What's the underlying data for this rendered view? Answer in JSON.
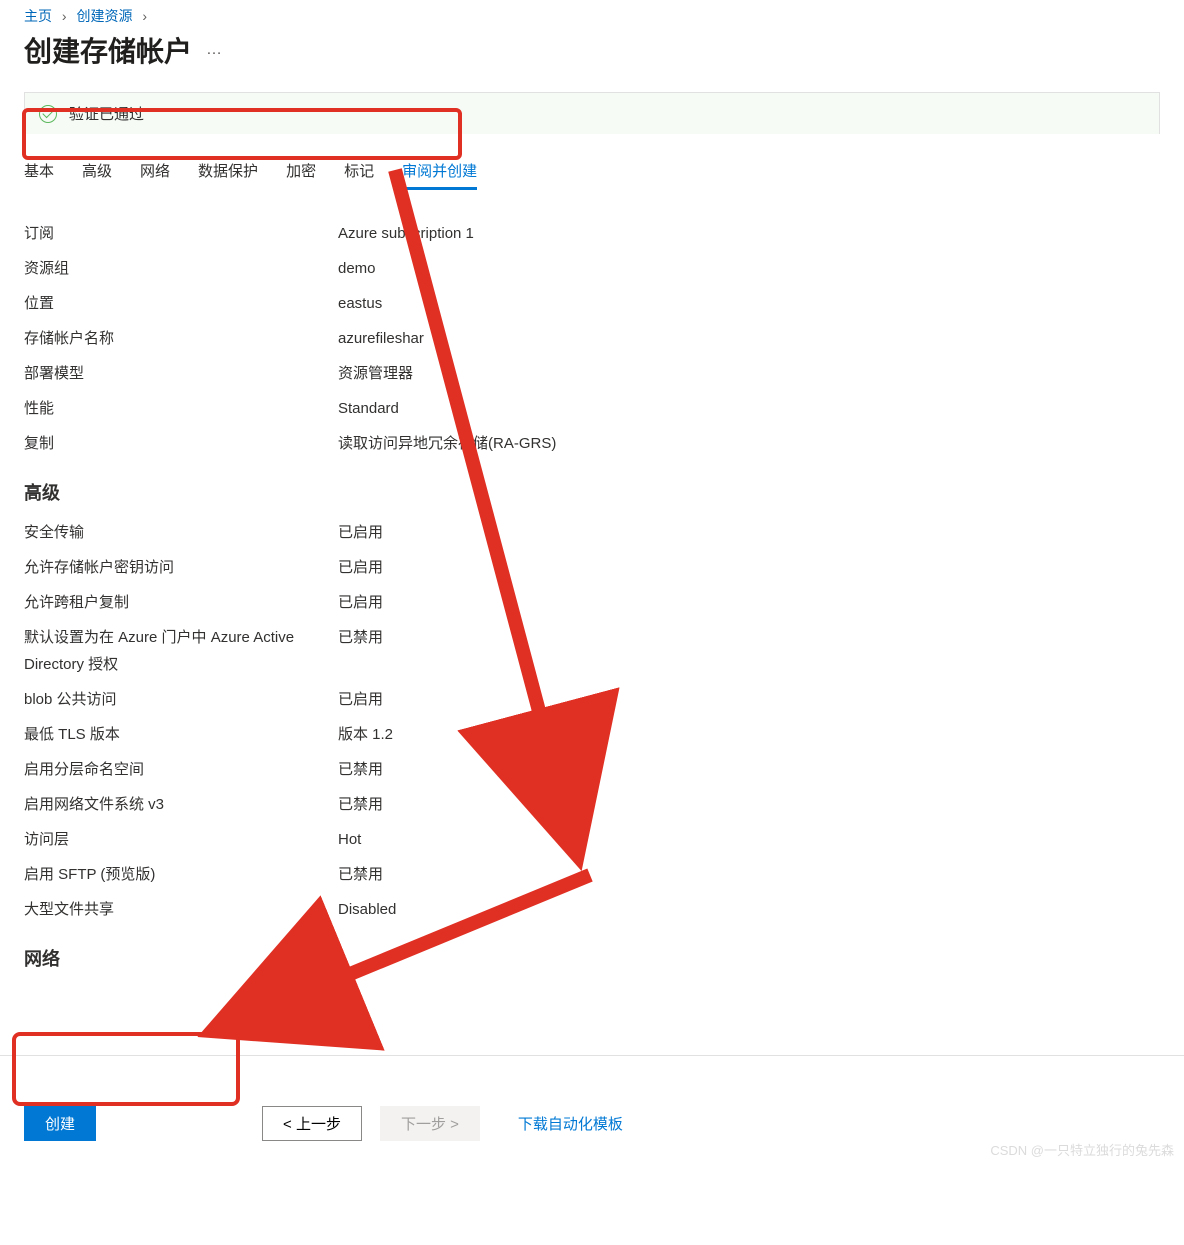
{
  "breadcrumb": {
    "home": "主页",
    "create_resource": "创建资源"
  },
  "page_title": "创建存储帐户",
  "validation_text": "验证已通过",
  "tabs": {
    "basic": "基本",
    "advanced": "高级",
    "network": "网络",
    "data_protection": "数据保护",
    "encryption": "加密",
    "tags": "标记",
    "review": "审阅并创建"
  },
  "basic": {
    "subscription_label": "订阅",
    "subscription_value": "Azure subscription 1",
    "resource_group_label": "资源组",
    "resource_group_value": "demo",
    "location_label": "位置",
    "location_value": "eastus",
    "storage_name_label": "存储帐户名称",
    "storage_name_value": "azurefileshar",
    "deploy_model_label": "部署模型",
    "deploy_model_value": "资源管理器",
    "performance_label": "性能",
    "performance_value": "Standard",
    "replication_label": "复制",
    "replication_value": "读取访问异地冗余存储(RA-GRS)"
  },
  "advanced_heading": "高级",
  "advanced": {
    "secure_transfer_label": "安全传输",
    "secure_transfer_value": "已启用",
    "key_access_label": "允许存储帐户密钥访问",
    "key_access_value": "已启用",
    "cross_tenant_label": "允许跨租户复制",
    "cross_tenant_value": "已启用",
    "aad_default_label": "默认设置为在 Azure 门户中 Azure Active Directory 授权",
    "aad_default_value": "已禁用",
    "blob_public_label": "blob 公共访问",
    "blob_public_value": "已启用",
    "min_tls_label": "最低 TLS 版本",
    "min_tls_value": "版本 1.2",
    "hns_label": "启用分层命名空间",
    "hns_value": "已禁用",
    "nfs_label": "启用网络文件系统 v3",
    "nfs_value": "已禁用",
    "access_tier_label": "访问层",
    "access_tier_value": "Hot",
    "sftp_label": "启用 SFTP (预览版)",
    "sftp_value": "已禁用",
    "large_fs_label": "大型文件共享",
    "large_fs_value": "Disabled"
  },
  "network_heading": "网络",
  "footer": {
    "create": "创建",
    "prev": "< 上一步",
    "next": "下一步 >",
    "download": "下载自动化模板"
  },
  "watermark": "CSDN @一只特立独行的兔先森",
  "annotation": {
    "arrow_color": "#e02f23"
  }
}
